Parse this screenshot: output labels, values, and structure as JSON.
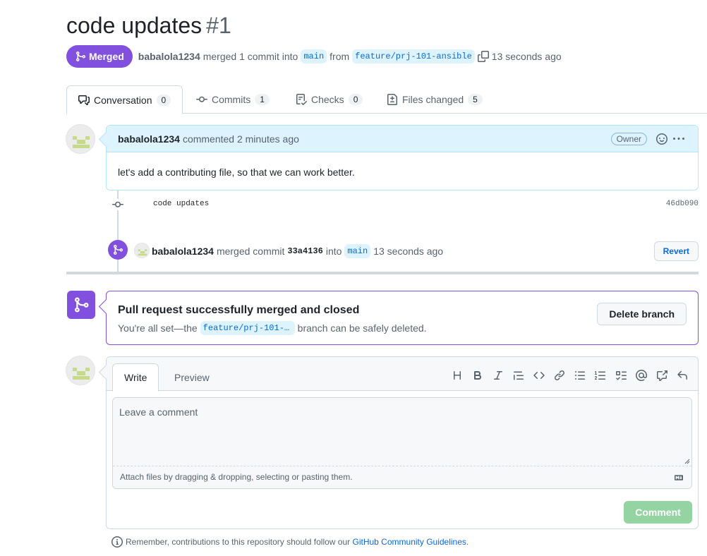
{
  "pr": {
    "title": "code updates",
    "number": "#1",
    "state": "Merged",
    "author": "babalola1234",
    "action_text": "merged 1 commit into",
    "base_branch": "main",
    "from_text": "from",
    "head_branch": "feature/prj-101-ansible",
    "time": "13 seconds ago"
  },
  "tabs": [
    {
      "label": "Conversation",
      "count": "0",
      "icon": "comment-discussion-icon"
    },
    {
      "label": "Commits",
      "count": "1",
      "icon": "git-commit-icon"
    },
    {
      "label": "Checks",
      "count": "0",
      "icon": "checklist-icon"
    },
    {
      "label": "Files changed",
      "count": "5",
      "icon": "file-diff-icon"
    }
  ],
  "comment": {
    "author": "babalola1234",
    "time": "commented 2 minutes ago",
    "role": "Owner",
    "body": "let's add a contributing file, so that we can work better."
  },
  "commit": {
    "message": "code updates",
    "sha": "46db090"
  },
  "merge_event": {
    "author": "babalola1234",
    "text": "merged commit",
    "sha": "33a4136",
    "into": "into",
    "branch": "main",
    "time": "13 seconds ago",
    "revert_label": "Revert"
  },
  "merged_box": {
    "title": "Pull request successfully merged and closed",
    "prefix": "You're all set—the",
    "branch": "feature/prj-101-an…",
    "suffix": "branch can be safely deleted.",
    "delete_label": "Delete branch"
  },
  "editor": {
    "write_tab": "Write",
    "preview_tab": "Preview",
    "placeholder": "Leave a comment",
    "attach_text": "Attach files by dragging & dropping, selecting or pasting them.",
    "submit_label": "Comment"
  },
  "footnote": {
    "text": "Remember, contributions to this repository should follow our",
    "link": "GitHub Community Guidelines",
    "end": "."
  },
  "colors": {
    "merged": "#8250df",
    "link": "#0969da",
    "comment_header": "#ddf4ff",
    "disabled_green": "#94d3a2"
  }
}
